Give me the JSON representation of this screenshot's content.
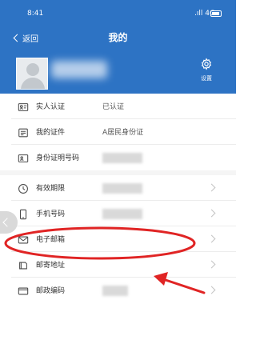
{
  "status_bar": {
    "time": "8:41",
    "signal": ".ıll 4G"
  },
  "nav": {
    "back_label": "返回",
    "title": "我的"
  },
  "profile": {
    "settings_label": "设置"
  },
  "list": [
    {
      "label": "实人认证",
      "value": "已认证",
      "icon": "id-card-icon",
      "has_arrow": false
    },
    {
      "label": "我的证件",
      "value": "A居民身份证",
      "icon": "document-icon",
      "has_arrow": false
    },
    {
      "label": "身份证明号码",
      "value": "",
      "icon": "id-number-icon",
      "has_arrow": false
    },
    {
      "label": "有效期限",
      "value": "",
      "icon": "clock-icon",
      "has_arrow": true
    },
    {
      "label": "手机号码",
      "value": "",
      "icon": "phone-icon",
      "has_arrow": true
    },
    {
      "label": "电子邮箱",
      "value": "",
      "icon": "mail-icon",
      "has_arrow": true
    },
    {
      "label": "邮寄地址",
      "value": "",
      "icon": "address-icon",
      "has_arrow": true
    },
    {
      "label": "邮政编码",
      "value": "",
      "icon": "postcode-icon",
      "has_arrow": true
    }
  ],
  "colors": {
    "header_bg": "#2d73c4",
    "annotation_red": "#e02424"
  }
}
